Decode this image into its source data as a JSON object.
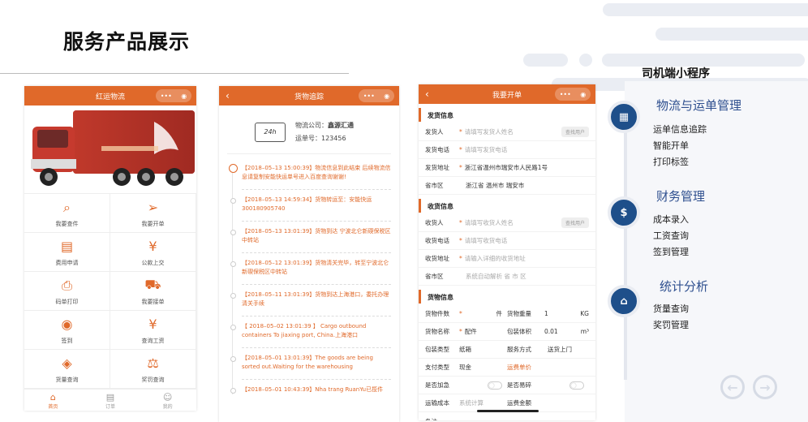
{
  "page_title": "服务产品展示",
  "phone1": {
    "title": "红运物流",
    "menu": [
      {
        "label": "我要查件",
        "icon": "search-icon",
        "glyph": "⌕"
      },
      {
        "label": "我要开单",
        "icon": "send-icon",
        "glyph": "➢"
      },
      {
        "label": "费用申请",
        "icon": "document-icon",
        "glyph": "▤"
      },
      {
        "label": "公款上交",
        "icon": "yen-icon",
        "glyph": "¥"
      },
      {
        "label": "码单打印",
        "icon": "printer-icon",
        "glyph": "⎙"
      },
      {
        "label": "我要接单",
        "icon": "truck-icon",
        "glyph": "⛟"
      },
      {
        "label": "签到",
        "icon": "checkin-icon",
        "glyph": "◉"
      },
      {
        "label": "查询工资",
        "icon": "wallet-icon",
        "glyph": "¥"
      },
      {
        "label": "货量查询",
        "icon": "box-icon",
        "glyph": "◈"
      },
      {
        "label": "奖罚查询",
        "icon": "scale-icon",
        "glyph": "⚖"
      }
    ],
    "tabs": [
      {
        "label": "首页",
        "icon": "home-icon",
        "glyph": "⌂"
      },
      {
        "label": "订单",
        "icon": "order-icon",
        "glyph": "▤"
      },
      {
        "label": "我的",
        "icon": "user-icon",
        "glyph": "☺"
      }
    ]
  },
  "phone2": {
    "title": "货物追踪",
    "company_label": "物流公司：",
    "company": "鑫源汇通",
    "waybill_label": "运单号：",
    "waybill": "123456",
    "badge": "24h",
    "events": [
      "【2018–05–13 15:00:39】物流信息到此结束 后续物流信息请复制安能快运单号进入百度查询谢谢!",
      "【2018–05–13 14:59:34】货物转运至：安能快运300180905740",
      "【2018–05–13 13:01:39】货物到达 宁波北仑新碶保税区中转站",
      "【2018–05–12 13:01:39】货物清关完毕，转至宁波北仑新碶保税区中转站",
      "【2018–05–11 13:01:39】货物到达上海港口，委托办理清关手续",
      "【 2018–05–02 13:01:39 】 Cargo outbound containers To jiaxing port, China.上海港口",
      "【2018–05–01 13:01:39】The goods are being sorted out.Waiting for the warehousing",
      "【2018–05–01 10:43:39】Nha trang RuanYu已揽件"
    ]
  },
  "phone3": {
    "title": "我要开单",
    "sender_section": "发货信息",
    "sender_name_label": "发货人",
    "sender_name_ph": "请填写发货人姓名",
    "find_user": "查找用户",
    "sender_phone_label": "发货电话",
    "sender_phone_ph": "请填写发货电话",
    "sender_addr_label": "发货地址",
    "sender_addr": "浙江省温州市瑞安市人民路1号",
    "region_label": "省市区",
    "sender_region": "浙江省 温州市 瑞安市",
    "receiver_section": "收货信息",
    "receiver_name_label": "收货人",
    "receiver_name_ph": "请填写收货人姓名",
    "receiver_phone_label": "收货电话",
    "receiver_phone_ph": "请填写收货电话",
    "receiver_addr_label": "收货地址",
    "receiver_addr_ph": "请输入详细的收货地址",
    "receiver_region_ph": "系统自动解析 省 市 区",
    "goods_section": "货物信息",
    "count_label": "货物件数",
    "count_unit": "件",
    "weight_label": "货物重量",
    "weight": "1",
    "weight_unit": "KG",
    "name_label": "货物名称",
    "name": "配件",
    "volume_label": "包装体积",
    "volume": "0.01",
    "volume_unit": "m³",
    "pack_label": "包装类型",
    "pack": "纸箱",
    "service_label": "服务方式",
    "service": "送货上门",
    "pay_label": "支付类型",
    "pay": "现金",
    "unit_price_label": "运费单价",
    "urgent_label": "是否加急",
    "fragile_label": "是否易碎",
    "cost_label": "运输成本",
    "cost_ph": "系统计算",
    "amount_label": "运费金额",
    "note_label": "备注"
  },
  "right": {
    "heading": "司机端小程序",
    "groups": [
      {
        "title": "物流与运单管理",
        "icon": "chart-monitor-icon",
        "glyph": "▦",
        "items": [
          "运单信息追踪",
          "智能开单",
          "打印标签"
        ]
      },
      {
        "title": "财务管理",
        "icon": "money-icon",
        "glyph": "$",
        "items": [
          "成本录入",
          "工资查询",
          "签到管理"
        ]
      },
      {
        "title": "统计分析",
        "icon": "house-dollar-icon",
        "glyph": "⌂",
        "items": [
          "货量查询",
          "奖罚管理"
        ]
      }
    ],
    "prev": "←",
    "next": "→"
  }
}
